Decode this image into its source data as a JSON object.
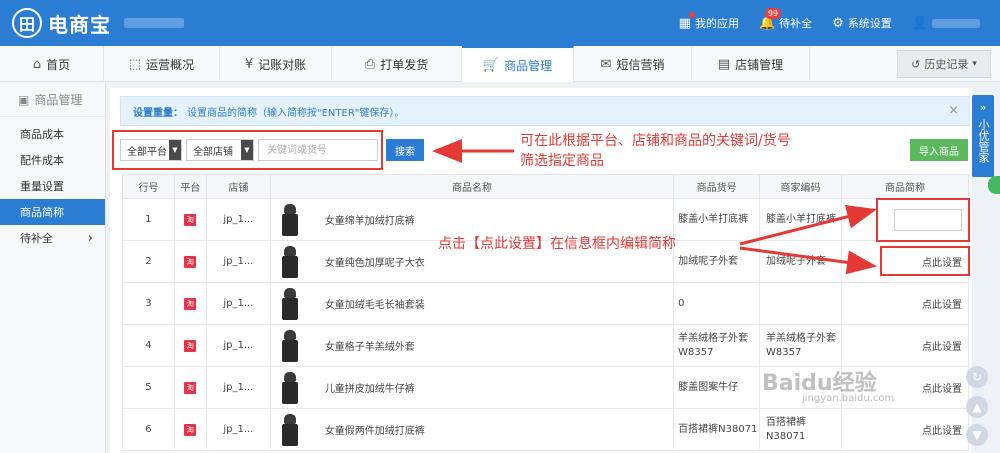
{
  "app": {
    "logo_glyph": "田",
    "logo_text": "电商宝"
  },
  "topbar": {
    "my_apps": "我的应用",
    "restock": "待补全",
    "restock_badge": "99",
    "settings": "系统设置"
  },
  "nav": {
    "tabs": [
      {
        "label": "首页",
        "icon": "home-icon"
      },
      {
        "label": "运营概况",
        "icon": "chart-icon"
      },
      {
        "label": "记账对账",
        "icon": "yen-icon"
      },
      {
        "label": "打单发货",
        "icon": "printer-icon"
      },
      {
        "label": "商品管理",
        "icon": "cart-icon"
      },
      {
        "label": "短信营销",
        "icon": "mail-icon"
      },
      {
        "label": "店铺管理",
        "icon": "shop-icon"
      }
    ],
    "active_tab": "商品管理",
    "history": "历史记录"
  },
  "sidebar": {
    "title": "商品管理",
    "items": [
      {
        "label": "商品成本"
      },
      {
        "label": "配件成本"
      },
      {
        "label": "重量设置"
      },
      {
        "label": "商品简称"
      },
      {
        "label": "待补全"
      }
    ],
    "active": "商品简称"
  },
  "notice": {
    "bold": "设置重量：",
    "text": "设置商品的简称（输入简称按\"ENTER\"键保存）。",
    "close": "×"
  },
  "filters": {
    "platform": "全部平台",
    "shop": "全部店铺",
    "keyword_placeholder": "关键词或货号",
    "search_button": "搜索",
    "import_button": "导入商品"
  },
  "annotations": {
    "filter_line1": "可在此根据平台、店铺和商品的关键词/货号",
    "filter_line2": "筛选指定商品",
    "edit_hint": "点击【点此设置】在信息框内编辑简称"
  },
  "table": {
    "headers": [
      "行号",
      "平台",
      "店铺",
      "商品名称",
      "商品货号",
      "商家编码",
      "商品简称"
    ],
    "set_link": "点此设置",
    "platform_badge": "淘",
    "rows": [
      {
        "no": "1",
        "shop": "jp_1...",
        "name": "女童绵羊加绒打底裤",
        "code": "膝盖小羊打底裤",
        "merchant": "膝盖小羊打底裤",
        "editing": true
      },
      {
        "no": "2",
        "shop": "jp_1...",
        "name": "女童纯色加厚呢子大衣",
        "code": "加绒呢子外套",
        "merchant": "加绒呢子外套",
        "editing": false
      },
      {
        "no": "3",
        "shop": "jp_1...",
        "name": "女童加绒毛毛长袖套装",
        "code": "0",
        "merchant": "",
        "editing": false
      },
      {
        "no": "4",
        "shop": "jp_1...",
        "name": "女童格子羊羔绒外套",
        "code": "羊羔绒格子外套 W8357",
        "merchant": "羊羔绒格子外套 W8357",
        "editing": false
      },
      {
        "no": "5",
        "shop": "jp_1...",
        "name": "儿童拼皮加绒牛仔裤",
        "code": "膝盖图案牛仔",
        "merchant": "",
        "editing": false
      },
      {
        "no": "6",
        "shop": "jp_1...",
        "name": "女童假两件加绒打底裤",
        "code": "百搭裙裤N38071",
        "merchant": "百搭裙裤N38071",
        "editing": false
      }
    ]
  },
  "float": {
    "label": "小优管家"
  },
  "watermark": {
    "main": "Baidu经验",
    "sub": "jingyan.baidu.com"
  },
  "colors": {
    "primary": "#2b7cd3",
    "annotation": "#e53935",
    "import": "#5cb85c"
  }
}
